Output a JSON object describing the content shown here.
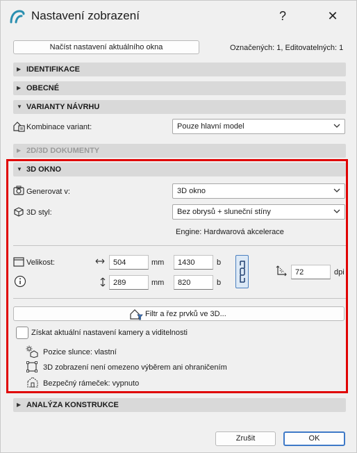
{
  "window": {
    "title": "Nastavení zobrazení",
    "help_glyph": "?",
    "close_glyph": "✕"
  },
  "top": {
    "load_button": "Načíst nastavení aktuálního okna",
    "selection_info": "Označených: 1, Editovatelných: 1"
  },
  "sections": {
    "identifikace": "IDENTIFIKACE",
    "obecne": "OBECNÉ",
    "varianty": "VARIANTY NÁVRHU",
    "dokumenty": "2D/3D DOKUMENTY",
    "okno3d": "3D OKNO",
    "analyza": "ANALÝZA KONSTRUKCE"
  },
  "varianty": {
    "label": "Kombinace variant:",
    "value": "Pouze hlavní model"
  },
  "okno3d": {
    "generate_label": "Generovat v:",
    "generate_value": "3D okno",
    "style_label": "3D styl:",
    "style_value": "Bez obrysů + sluneční stíny",
    "engine": "Engine: Hardwarová akcelerace",
    "size_label": "Velikost:",
    "width_mm": "504",
    "height_mm": "289",
    "unit_mm": "mm",
    "width_px": "1430",
    "height_px": "820",
    "unit_px": "b",
    "dpi_value": "72",
    "dpi_unit": "dpi",
    "filter_button": "Filtr a řez prvků ve 3D...",
    "camera_checkbox": "Získat aktuální nastavení kamery a viditelnosti",
    "sun_position": "Pozice slunce: vlastní",
    "not_limited": "3D zobrazení není omezeno výběrem ani ohraničením",
    "safe_frame": "Bezpečný rámeček: vypnuto"
  },
  "footer": {
    "cancel": "Zrušit",
    "ok": "OK"
  },
  "colors": {
    "highlight_border": "#e00000",
    "brand_teal": "#2a8fb0"
  }
}
